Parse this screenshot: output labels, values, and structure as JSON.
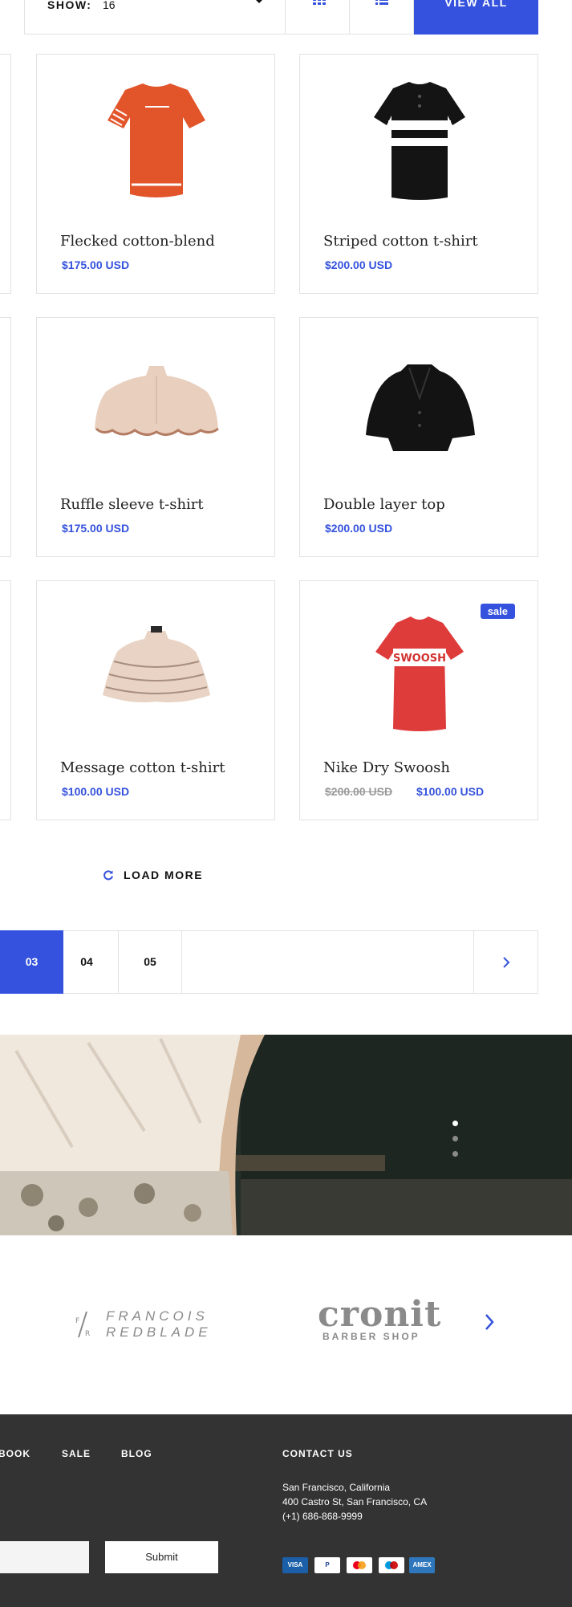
{
  "toolbar": {
    "show_label": "SHOW:",
    "show_value": "16",
    "view_all_label": "VIEW ALL",
    "icons": [
      "grid-view-icon",
      "list-view-icon",
      "chevron-down-icon"
    ]
  },
  "products": [
    {
      "name": "Flecked cotton-blend",
      "price": "$175.00 USD",
      "image": "orange-tshirt"
    },
    {
      "name": "Striped cotton t-shirt",
      "price": "$200.00 USD",
      "image": "black-polo-striped"
    },
    {
      "name": "Ruffle sleeve t-shirt",
      "price": "$175.00 USD",
      "image": "beige-ruffle-cape"
    },
    {
      "name": "Double layer top",
      "price": "$200.00 USD",
      "image": "black-cape-jacket"
    },
    {
      "name": "Message cotton t-shirt",
      "price": "$100.00 USD",
      "image": "beige-tiered-ruffle"
    },
    {
      "name": "Nike Dry Swoosh",
      "price_old": "$200.00 USD",
      "price_new": "$100.00 USD",
      "badge": "sale",
      "image": "red-swoosh-tshirt"
    }
  ],
  "load_more": {
    "label": "LOAD MORE",
    "icon": "refresh-icon"
  },
  "pagination": {
    "pages": [
      "03",
      "04",
      "05"
    ],
    "active": "03",
    "next_icon": "chevron-right-icon"
  },
  "banner": {
    "slide_count": 3,
    "active_slide": 1
  },
  "brands": {
    "brand1_line1": "FRANCOIS",
    "brand1_line2": "REDBLADE",
    "brand1_mark": "F/R",
    "brand2_name": "cronit",
    "brand2_sub": "BARBER SHOP"
  },
  "footer": {
    "nav": [
      "BOOK",
      "SALE",
      "BLOG"
    ],
    "contact_heading": "CONTACT US",
    "address_line1": "San Francisco, California",
    "address_line2": "400 Castro St, San Francisco, CA",
    "phone": "(+1) 686-868-9999",
    "submit_label": "Submit",
    "payment_methods": [
      "VISA",
      "PayPal",
      "Mastercard",
      "Maestro",
      "AMEX"
    ]
  },
  "colors": {
    "accent": "#3452dd",
    "footer_bg": "#333333",
    "border": "#e2e2e2"
  }
}
